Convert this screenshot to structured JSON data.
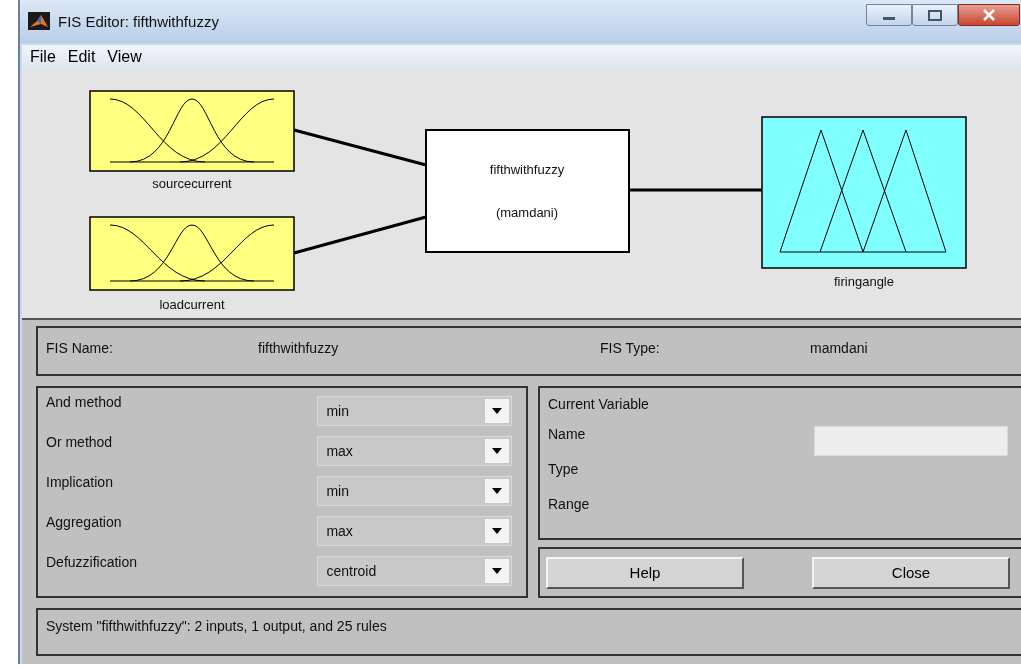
{
  "window": {
    "title": "FIS Editor: fifthwithfuzzy"
  },
  "menu": [
    "File",
    "Edit",
    "View"
  ],
  "diagram": {
    "inputs": [
      {
        "name": "sourcecurrent"
      },
      {
        "name": "loadcurrent"
      }
    ],
    "system": {
      "name": "fifthwithfuzzy",
      "type_label": "(mamdani)"
    },
    "outputs": [
      {
        "name": "firingangle"
      }
    ]
  },
  "fis_info": {
    "name_label": "FIS Name:",
    "name": "fifthwithfuzzy",
    "type_label": "FIS Type:",
    "type": "mamdani"
  },
  "methods": [
    {
      "label": "And method",
      "value": "min"
    },
    {
      "label": "Or method",
      "value": "max"
    },
    {
      "label": "Implication",
      "value": "min"
    },
    {
      "label": "Aggregation",
      "value": "max"
    },
    {
      "label": "Defuzzification",
      "value": "centroid"
    }
  ],
  "current_variable": {
    "title": "Current Variable",
    "fields": [
      {
        "label": "Name",
        "kind": "input"
      },
      {
        "label": "Type",
        "kind": "text"
      },
      {
        "label": "Range",
        "kind": "text"
      }
    ]
  },
  "buttons": [
    "Help",
    "Close"
  ],
  "status": "System \"fifthwithfuzzy\": 2 inputs, 1 output, and 25 rules"
}
